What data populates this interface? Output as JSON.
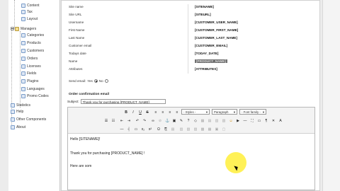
{
  "sidebar": {
    "items": [
      {
        "label": "Content",
        "level": 2
      },
      {
        "label": "Tax",
        "level": 2
      },
      {
        "label": "Layout",
        "level": 2
      },
      {
        "label": "Managers",
        "level": 1,
        "expanded": true
      },
      {
        "label": "Categories",
        "level": 2
      },
      {
        "label": "Products",
        "level": 2
      },
      {
        "label": "Customers",
        "level": 2
      },
      {
        "label": "Orders",
        "level": 2
      },
      {
        "label": "Licenses",
        "level": 2
      },
      {
        "label": "Fields",
        "level": 2
      },
      {
        "label": "Plugins",
        "level": 2
      },
      {
        "label": "Languages",
        "level": 2
      },
      {
        "label": "Promo Codes",
        "level": 2
      },
      {
        "label": "Statistics",
        "level": 1
      },
      {
        "label": "Help",
        "level": 1
      },
      {
        "label": "Other Components",
        "level": 1
      },
      {
        "label": "About",
        "level": 1
      }
    ]
  },
  "placeholders": [
    {
      "key": "Site name",
      "value": "[SITENAME]"
    },
    {
      "key": "Site URL",
      "value": "[SITEURL]"
    },
    {
      "key": "Username",
      "value": "[CUSTOMER_USER_NAME]"
    },
    {
      "key": "First Name",
      "value": "[CUSTOMER_FIRST_NAME]"
    },
    {
      "key": "Last Name",
      "value": "[CUSTOMER_LAST_NAME]"
    },
    {
      "key": "Customer email",
      "value": "[CUSTOMER_EMAIL]"
    },
    {
      "key": "Todays date",
      "value": "[TODAY_DATE]"
    },
    {
      "key": "Name",
      "value": "[PRODUCT_NAME]",
      "highlighted": true
    },
    {
      "key": "Attributes",
      "value": "[ATTRIBUTES]"
    }
  ],
  "send_email": {
    "label": "Send email:",
    "yes": "Yes",
    "no": "No",
    "selected": "yes"
  },
  "order_confirmation": {
    "title": "Order confirmation email",
    "subject_label": "Subject:",
    "subject_value": "Thank you for purchasing [PRODUCT_NAME]"
  },
  "editor": {
    "toolbar": {
      "styles": "- Styles -",
      "paragraph": "Paragraph",
      "font_family": "- Font family -"
    },
    "content": [
      "Hello [SITENAME]!",
      "Thank you for purchasing [PRODUCT_NAME] !",
      "Here are som"
    ]
  }
}
